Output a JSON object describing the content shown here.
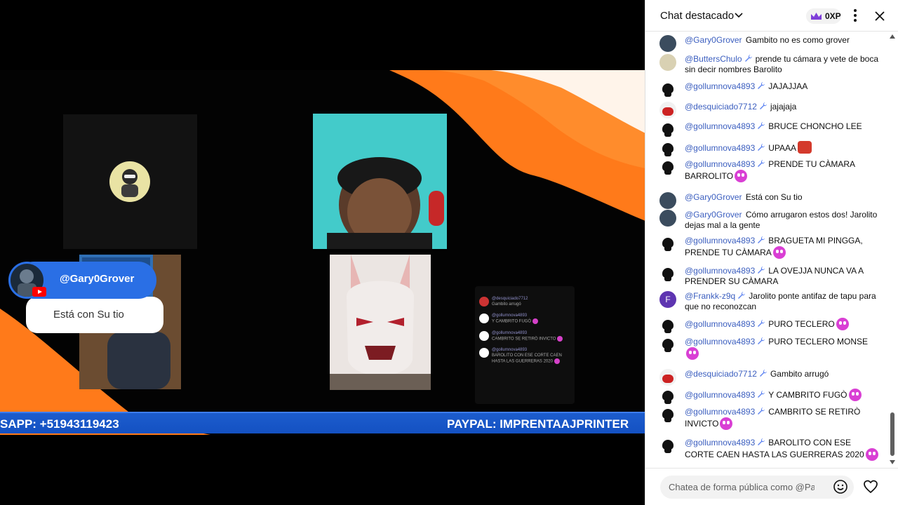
{
  "stream": {
    "lower_third": {
      "name": "@Gary0Grover",
      "message": "Está con Su tio"
    },
    "ticker": {
      "left": "SAPP: +51943119423",
      "right": "PAYPAL: IMPRENTAAJPRINTER"
    },
    "mini_chat": [
      {
        "author": "@desquiciado7712",
        "text": "Gambito arrugó",
        "emoji": false
      },
      {
        "author": "@gollumnova4893",
        "text": "Y CAMBRITO FUGÒ",
        "emoji": true
      },
      {
        "author": "@gollumnova4893",
        "text": "CAMBRITO SE RETIRÒ INVICTO",
        "emoji": true
      },
      {
        "author": "@gollumnova4893",
        "text": "BAROLITO CON ESE CORTE CAEN HASTA LAS GUERRERAS 2020",
        "emoji": true
      }
    ],
    "accent_orange": "#ff7a1a",
    "accent_blue": "#1c5ccd"
  },
  "chat": {
    "title": "Chat destacado",
    "xp": "0XP",
    "input_placeholder": "Chatea de forma pública como @Paul...",
    "messages": [
      {
        "author": "@Gary0Grover",
        "text": "Gambito no es como grover",
        "avatar": "gary",
        "mod": false
      },
      {
        "author": "@ButtersChulo",
        "text": "prende tu cámara y vete de boca sin decir nombres Barolito",
        "avatar": "butters",
        "mod": true
      },
      {
        "author": "@gollumnova4893",
        "text": "JAJAJJAA",
        "avatar": "skull",
        "mod": true
      },
      {
        "author": "@desquiciado7712",
        "text": "jajajaja",
        "avatar": "desq",
        "mod": true
      },
      {
        "author": "@gollumnova4893",
        "text": "BRUCE CHONCHO LEE",
        "avatar": "skull",
        "mod": true
      },
      {
        "author": "@gollumnova4893",
        "text": "UPAAA",
        "avatar": "skull",
        "mod": true,
        "emoji": "red"
      },
      {
        "author": "@gollumnova4893",
        "text": "PRENDE TU CÀMARA BARROLITO",
        "avatar": "skull",
        "mod": true,
        "emoji": "pink"
      },
      {
        "author": "@Gary0Grover",
        "text": "Está con Su tio",
        "avatar": "gary",
        "mod": false
      },
      {
        "author": "@Gary0Grover",
        "text": "Cómo arrugaron estos dos! Jarolito dejas mal a la gente",
        "avatar": "gary",
        "mod": false
      },
      {
        "author": "@gollumnova4893",
        "text": "BRAGUETA MI PINGGA, PRENDE TU CÀMARA",
        "avatar": "skull",
        "mod": true,
        "emoji": "pink"
      },
      {
        "author": "@gollumnova4893",
        "text": "LA OVEJJA NUNCA VA A PRENDER SU CÀMARA",
        "avatar": "skull",
        "mod": true
      },
      {
        "author": "@Frankk-z9q",
        "text": "Jarolito ponte antifaz de tapu para que no reconozcan",
        "avatar": "frankk",
        "mod": true,
        "initial": "F"
      },
      {
        "author": "@gollumnova4893",
        "text": "PURO TECLERO",
        "avatar": "skull",
        "mod": true,
        "emoji": "pink"
      },
      {
        "author": "@gollumnova4893",
        "text": "PURO TECLERO MONSE",
        "avatar": "skull",
        "mod": true,
        "emoji": "pink"
      },
      {
        "author": "@desquiciado7712",
        "text": "Gambito arrugó",
        "avatar": "desq",
        "mod": true
      },
      {
        "author": "@gollumnova4893",
        "text": "Y CAMBRITO FUGÒ",
        "avatar": "skull",
        "mod": true,
        "emoji": "pink"
      },
      {
        "author": "@gollumnova4893",
        "text": "CAMBRITO SE RETIRÒ INVICTO",
        "avatar": "skull",
        "mod": true,
        "emoji": "pink"
      },
      {
        "author": "@gollumnova4893",
        "text": "BAROLITO CON ESE CORTE CAEN HASTA LAS GUERRERAS 2020",
        "avatar": "skull",
        "mod": true,
        "emoji": "pink"
      }
    ]
  }
}
